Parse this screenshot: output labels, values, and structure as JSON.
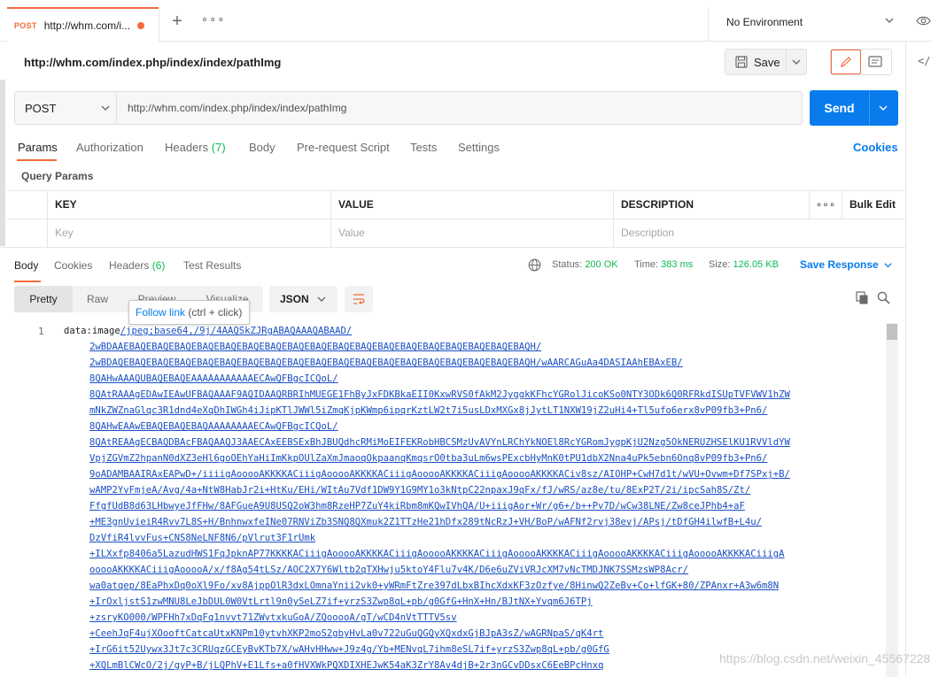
{
  "tab": {
    "method": "POST",
    "url": "http://whm.com/i..."
  },
  "environment": {
    "label": "No Environment"
  },
  "request": {
    "title": "http://whm.com/index.php/index/index/pathImg",
    "save_label": "Save"
  },
  "url_bar": {
    "method": "POST",
    "url": "http://whm.com/index.php/index/index/pathImg",
    "send_label": "Send"
  },
  "request_tabs": [
    {
      "label": "Params",
      "count": ""
    },
    {
      "label": "Authorization",
      "count": ""
    },
    {
      "label": "Headers",
      "count": "(7)"
    },
    {
      "label": "Body",
      "count": ""
    },
    {
      "label": "Pre-request Script",
      "count": ""
    },
    {
      "label": "Tests",
      "count": ""
    },
    {
      "label": "Settings",
      "count": ""
    }
  ],
  "cookies_label": "Cookies",
  "query_params": {
    "title": "Query Params",
    "headers": {
      "key": "KEY",
      "value": "VALUE",
      "description": "DESCRIPTION",
      "more": "∘∘∘",
      "bulk_edit": "Bulk Edit"
    },
    "placeholders": {
      "key": "Key",
      "value": "Value",
      "description": "Description"
    }
  },
  "response_tabs": [
    {
      "label": "Body",
      "count": ""
    },
    {
      "label": "Cookies",
      "count": ""
    },
    {
      "label": "Headers",
      "count": "(6)"
    },
    {
      "label": "Test Results",
      "count": ""
    }
  ],
  "response_status": {
    "status_label": "Status:",
    "status_value": "200 OK",
    "time_label": "Time:",
    "time_value": "383 ms",
    "size_label": "Size:",
    "size_value": "126.05 KB",
    "save_response": "Save Response"
  },
  "viewer": {
    "modes": [
      "Pretty",
      "Raw",
      "Preview",
      "Visualize"
    ],
    "format": "JSON",
    "tooltip_link": "Follow link",
    "tooltip_rest": " (ctrl + click)"
  },
  "code": {
    "line_number": "1",
    "prefix": "data:image",
    "lines": [
      "/jpeg;base64,/9j/4AAQSkZJRgABAQAAAQABAAD/",
      "2wBDAAEBAQEBAQEBAQEBAQEBAQEBAQEBAQEBAQEBAQEBAQEBAQEBAQEBAQEBAQEBAQEBAQEBAQEBAQH/",
      "2wBDAQEBAQEBAQEBAQEBAQEBAQEBAQEBAQEBAQEBAQEBAQEBAQEBAQEBAQEBAQEBAQEBAQEBAQEBAQH/wAARCAGuAa4DASIAAhEBAxEB/",
      "8QAHwAAAQUBAQEBAQEAAAAAAAAAAAECAwQFBgcICQoL/",
      "8QAtRAAAgEDAwIEAwUFBAQAAAF9AQIDAAQRBRIhMUEGE1FhByJxFDKBkaEII0KxwRVS0fAkM2JyggkKFhcYGRolJicoKSo0NTY3ODk6Q0RFRkdISUpTVFVWV1hZW",
      "mNkZWZnaGlqc3R1dnd4eXqDhIWGh4iJipKTlJWWl5iZmqKjpKWmp6ipqrKztLW2t7i5usLDxMXGx8jJytLT1NXW19jZ2uHi4+Tl5ufo6erx8vP09fb3+Pn6/",
      "8QAHwEAAwEBAQEBAQEBAQAAAAAAAAECAwQFBgcICQoL/",
      "8QAtREAAgECBAQDBAcFBAQAAQJ3AAECAxEEBSExBhJBUQdhcRMiMoEIFEKRobHBCSMzUvAVYnLRChYkNOEl8RcYGRomJygpKjU2Nzg5OkNERUZHSElKU1RVVldYW",
      "VpjZGVmZ2hpanN0dXZ3eHl6goOEhYaHiImKkpOUlZaXmJmaoqOkpaanqKmqsrO0tba3uLm6wsPExcbHyMnK0tPU1dbX2Nna4uPk5ebn6Onq8vP09fb3+Pn6/",
      "9oADAMBAAIRAxEAPwD+/iiiigAooooAKKKKACiiigAooooAKKKKACiiigAooooAKKKKACiiigAooooAKKKKACiv8sz/AIOHP+CwH7d1t/wVU+Ovwm+Df7SPxj+B/",
      "wAMP2YvFmjeA/Avg/4a+NtW8HabJr2i+HtKu/EHi/WItAu7Vdf1DW9Y1G9MY1o3kNtpC22npaxJ9qFx/fJ/wRS/az8e/tu/8ExP2T/2i/ipcSah8S/Zt/",
      "FfgfUdB8d63LHbwyeJfFHw/8AFGueA9U8USQ2oW3hm8RzeHP7ZuY4kiRbm8mKQwIVhQA/U+iiigAor+Wr/g6+/b++Pv7D/wCw38LNE/Zw8ceJPhb4+aF",
      "+ME3gnUvieiR4Rvv7L8S+H/BnhnwxfeINe07RNViZb3SNQ8QXmuk2Z1TTzHe21hDfx289tNcRzJ+VH/BoP/wAFNf2rvj38evj/APsj/tDfGH4ilwfB+L4u/",
      "DzVfiR4lvvFus+CNS8NeLNF8N6/pVlrut3F1rUmk",
      "+ILXxfp8406a5LazudHWS1FqJpknAP77KKKKACiiigAooooAKKKKACiiigAooooAKKKKACiiigAooooAKKKKACiiigAooooAKKKKACiiigAooooAKKKKACiiigA",
      "ooooAKKKKACiiigAooooA/x/f8Ag54tLSz/AOC2X7Y6Wltb2qTXHwju5ktoY4Flu7v4K/D6e6uZViVRJcXM7vNcTMDJNK7SSMzsWP8Acr/",
      "wa0atqep/8EaPhxDq0oXl9Fo/xv8AjppOlR3dxLOmnaYnii2vk0+yWRmFtZre397dLbxBIhcXdxKF3zOzfye/8HinwQ2ZeBv+Co+lfGK+80/ZPAnxr+A3w6m8N",
      "+IrOxljstS1zwMNU8LeJbDUL0W0VtLrtl9n0ySeLZ7if+yrzS3Zwp8qL+pb/g0GfG+HnX+Hn/BJtNX+Yvqm6J6TPj",
      "+zsryKO000/WPFHh7xDqFq1nvvt71ZWvtxkuGoA/ZQooooA/gT/wCD4nVtTTTV5sv",
      "+CeehJqF4ujXOooftCatcaUtxKNPm10ytvhXKP2moS2gbyHvLa0v722uGuQGQyXQxdxGjBJpA3sZ/wAGRNpaS/qK4rt",
      "+IrG6it52Uywx3Jt7c3CRUqzGCEyBvKTb7X/wAHvHHww+J9z4g/Yb+MENvqL7ihm8eSL7if+yrzS3Zwp8qL+pb/g0GfG",
      "+XQLmBlCWcO/2j/gyP+B/jLQPhV+E1Lfs+a0fHVXWkPQXDIXHEJwK54aK3ZrY8Av4djB+2r3nGCvDDsxC6EeBPcHnxq"
    ]
  },
  "watermark": "https://blog.csdn.net/weixin_45567228"
}
